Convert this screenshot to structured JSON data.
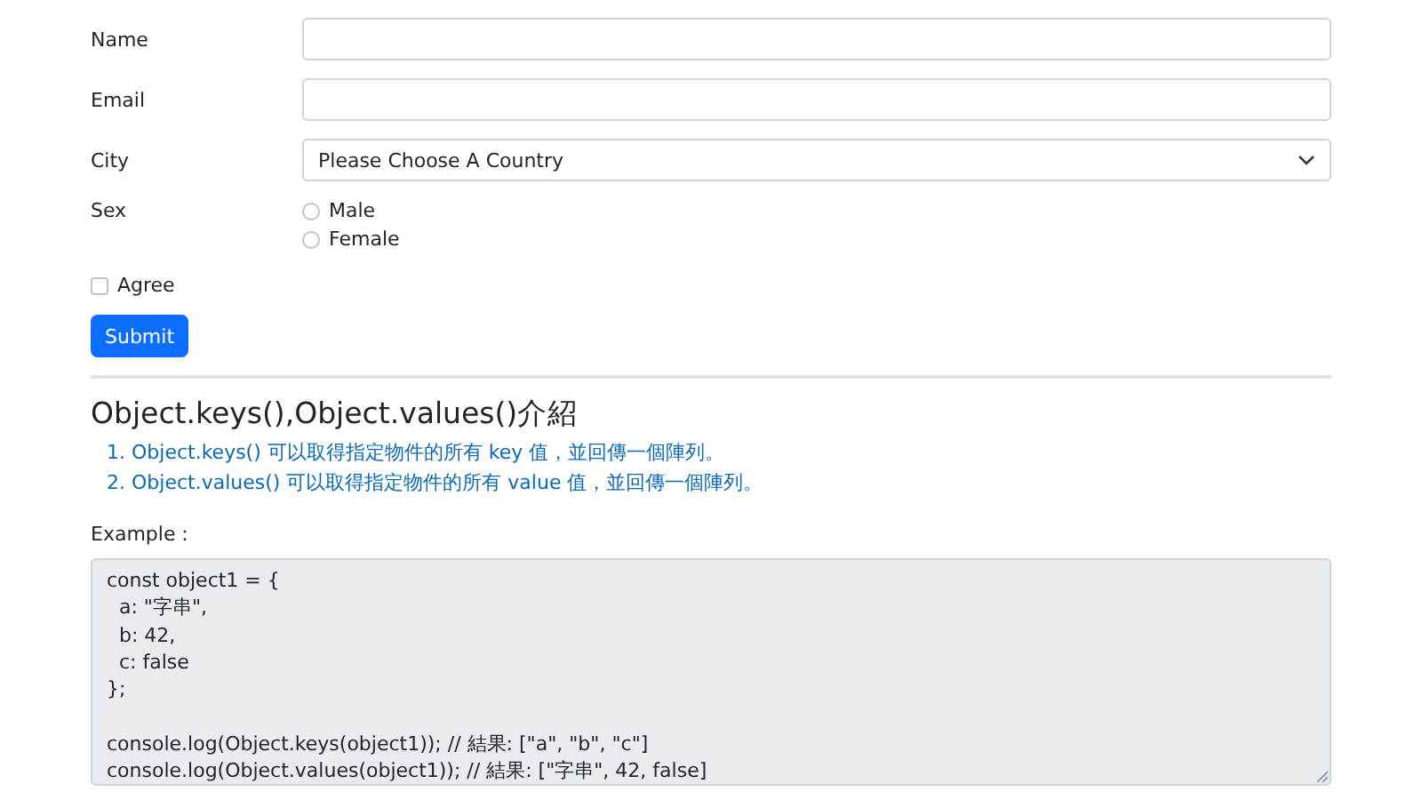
{
  "form": {
    "fields": [
      {
        "kind": "text",
        "label": "Name"
      },
      {
        "kind": "text",
        "label": "Email"
      },
      {
        "kind": "select",
        "label": "City",
        "value": "Please Choose A Country"
      }
    ],
    "sex": {
      "label": "Sex",
      "options": [
        {
          "label": "Male",
          "selected": false
        },
        {
          "label": "Female",
          "selected": false
        }
      ]
    },
    "agree": {
      "label": "Agree",
      "checked": false
    },
    "submit": "Submit"
  },
  "article": {
    "heading": "Object.keys(),Object.values()介紹",
    "items": [
      {
        "number": "1.",
        "text": "Object.keys() 可以取得指定物件的所有 key 值，並回傳一個陣列。"
      },
      {
        "number": "2.",
        "text": "Object.values() 可以取得指定物件的所有 value 值，並回傳一個陣列。"
      }
    ],
    "example_label": "Example：",
    "code": "const object1 = {\n  a: \"字串\",\n  b: 42,\n  c: false\n};\n\nconsole.log(Object.keys(object1)); // 結果: [\"a\", \"b\", \"c\"]\nconsole.log(Object.values(object1)); // 結果: [\"字串\", 42, false]"
  }
}
